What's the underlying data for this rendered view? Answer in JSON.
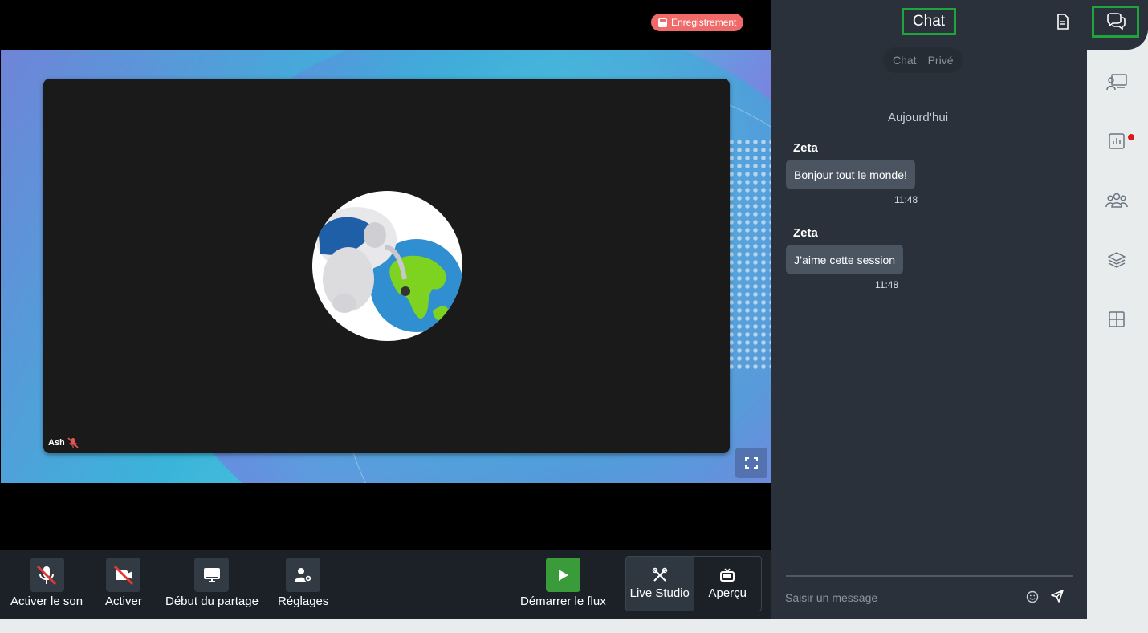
{
  "stage": {
    "recording_label": "Enregistrement",
    "participant_name": "Ash"
  },
  "toolbar": {
    "unmute_label": "Activer le son",
    "camera_label": "Activer",
    "share_label": "Début du partage",
    "settings_label": "Réglages",
    "start_stream_label": "Démarrer le flux",
    "live_studio_label": "Live Studio",
    "preview_label": "Aperçu"
  },
  "chat": {
    "title": "Chat",
    "tabs": [
      "Chat",
      "Privé"
    ],
    "date_separator": "Aujourd’hui",
    "messages": [
      {
        "author": "Zeta",
        "text": "Bonjour tout le monde!",
        "time": "11:48"
      },
      {
        "author": "Zeta",
        "text": "J’aime cette session",
        "time": "11:48"
      }
    ],
    "input_placeholder": "Saisir un message"
  },
  "rail": {
    "items": [
      "chat-icon",
      "presentation-icon",
      "poll-chart-icon",
      "participants-icon",
      "layers-icon",
      "layout-grid-icon"
    ],
    "notification_color": "#e01515"
  },
  "colors": {
    "highlight_border": "#1fa33c",
    "recording": "#f06a6a",
    "start_stream": "#3a9b3a"
  }
}
